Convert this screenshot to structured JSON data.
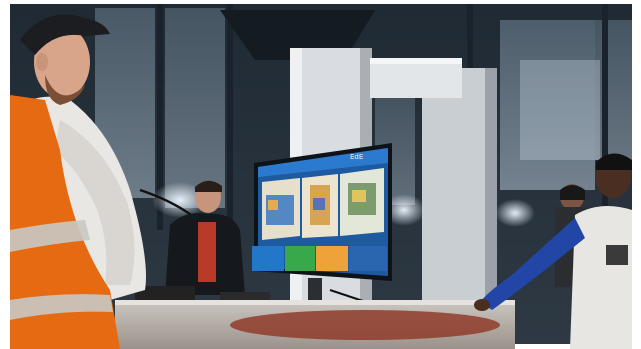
{
  "scene": {
    "description_colors": {
      "background": "#ffffff",
      "wall_dark": "#27353f",
      "window_light": "#b9cad8",
      "vest_orange": "#e66a12",
      "monitor_blue": "#1e5aa0",
      "panel_green": "#38a94b",
      "panel_orange": "#f0a23a",
      "jersey_blue": "#2146a6"
    },
    "monitor": {
      "brand_text": "EdE"
    }
  }
}
